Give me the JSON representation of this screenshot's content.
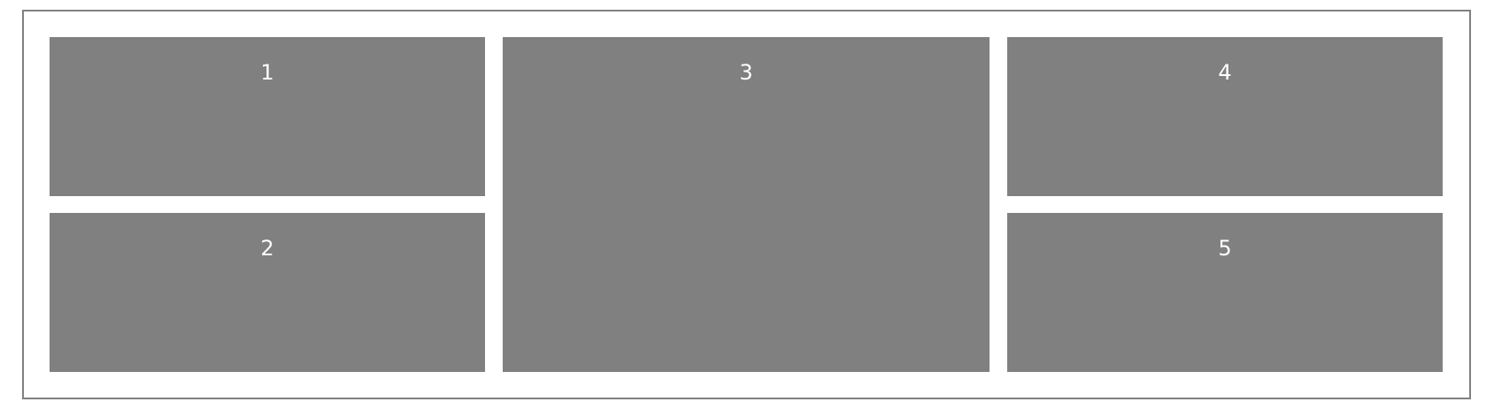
{
  "grid": {
    "cells": [
      {
        "label": "1"
      },
      {
        "label": "2"
      },
      {
        "label": "3"
      },
      {
        "label": "4"
      },
      {
        "label": "5"
      }
    ]
  },
  "colors": {
    "cell_background": "#808080",
    "cell_text": "#ffffff",
    "frame_border": "#808080",
    "page_background": "#ffffff"
  }
}
